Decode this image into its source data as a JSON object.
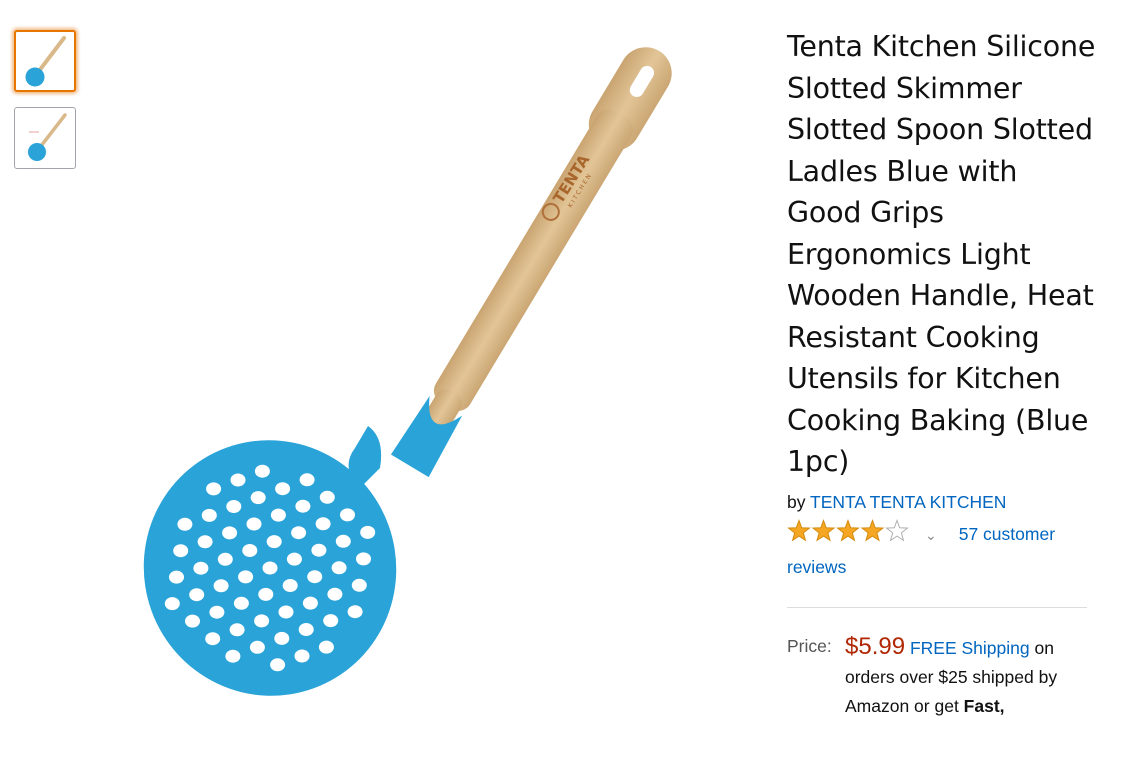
{
  "thumbnails": [
    {
      "alt": "spoon-thumbnail-1",
      "selected": true
    },
    {
      "alt": "spoon-thumbnail-2",
      "selected": false
    }
  ],
  "product": {
    "title": "Tenta Kitchen Silicone Slotted Skimmer Slotted Spoon Slotted Ladles Blue with Good Grips Ergonomics Light Wooden Handle, Heat Resistant Cooking Utensils for Kitchen Cooking Baking (Blue 1pc)",
    "by_label": "by",
    "brand": "TENTA TENTA KITCHEN",
    "image_logo_text": "TENTA",
    "image_logo_subtext": "KITCHEN",
    "rating": 4.0,
    "reviews_text": "57 customer reviews"
  },
  "pricing": {
    "label": "Price:",
    "price": "$5.99",
    "free_shipping_label": "FREE Shipping",
    "shipping_text_1": " on orders over $25 shipped by Amazon or get ",
    "shipping_text_bold": "Fast,"
  },
  "colors": {
    "link": "#0066c0",
    "price": "#b12704",
    "star": "#f5a623",
    "selected_border": "#e77600",
    "silicone_blue": "#2aa3d8",
    "wood": "#d9b98a"
  }
}
